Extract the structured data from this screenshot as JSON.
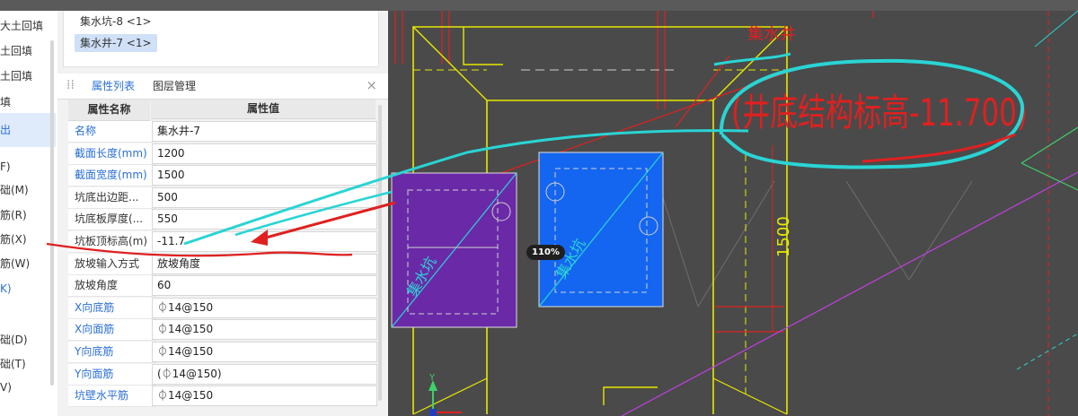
{
  "left_nav": {
    "items": [
      {
        "label": "大土回填",
        "state": "normal"
      },
      {
        "label": "土回填",
        "state": "normal"
      },
      {
        "label": "土回填",
        "state": "normal"
      },
      {
        "label": "填",
        "state": "normal"
      },
      {
        "label": "出",
        "state": "selected"
      },
      {
        "label": "F)",
        "state": "normal"
      },
      {
        "label": "础(M)",
        "state": "normal"
      },
      {
        "label": "筋(R)",
        "state": "normal"
      },
      {
        "label": "筋(X)",
        "state": "normal"
      },
      {
        "label": "筋(W)",
        "state": "normal"
      },
      {
        "label": "K)",
        "state": "link"
      },
      {
        "label": "础(D)",
        "state": "normal"
      },
      {
        "label": "础(T)",
        "state": "normal"
      },
      {
        "label": "V)",
        "state": "normal"
      }
    ]
  },
  "component_list": {
    "items": [
      "集水坑-8 <1>",
      "集水井-7 <1>"
    ],
    "selected_index": 1
  },
  "tabs": {
    "properties": "属性列表",
    "layers": "图层管理",
    "close_icon": "×",
    "grip_icon": "⁞⁞"
  },
  "property_table": {
    "header_name": "属性名称",
    "header_value": "属性值",
    "rows": [
      {
        "name": "名称",
        "value": "集水井-7",
        "blue": true
      },
      {
        "name": "截面长度(mm)",
        "value": "1200",
        "blue": true
      },
      {
        "name": "截面宽度(mm)",
        "value": "1500",
        "blue": true
      },
      {
        "name": "坑底出边距...",
        "value": "500",
        "blue": false
      },
      {
        "name": "坑底板厚度(...",
        "value": "550",
        "blue": false
      },
      {
        "name": "坑板顶标高(m)",
        "value": "-11.7",
        "blue": false
      },
      {
        "name": "放坡输入方式",
        "value": "放坡角度",
        "blue": false
      },
      {
        "name": "放坡角度",
        "value": "60",
        "blue": false
      },
      {
        "name": "X向底筋",
        "value": "⏀14@150",
        "blue": true
      },
      {
        "name": "X向面筋",
        "value": "⏀14@150",
        "blue": true
      },
      {
        "name": "Y向底筋",
        "value": "⏀14@150",
        "blue": true
      },
      {
        "name": "Y向面筋",
        "value": "(⏀14@150)",
        "blue": true
      },
      {
        "name": "坑壁水平筋",
        "value": "⏀14@150",
        "blue": true
      }
    ]
  },
  "cad_view": {
    "zoom_label": "110%",
    "header_label": "集水井",
    "elevation_text": "(井底结构标高-11.700)",
    "dimension_text": "1500",
    "pit_label_left": "集水坑",
    "pit_label_right": "集水坑",
    "y_axis_label": "Y",
    "colors": {
      "background": "#4a4a4a",
      "outline": "#e8e800",
      "dimension": "#e02020",
      "pit_left": "#6a2aa8",
      "pit_right": "#1466f0",
      "annotation": "#2ad4d4",
      "diagonal": "#c040e0"
    }
  },
  "collapse_icon": "<"
}
